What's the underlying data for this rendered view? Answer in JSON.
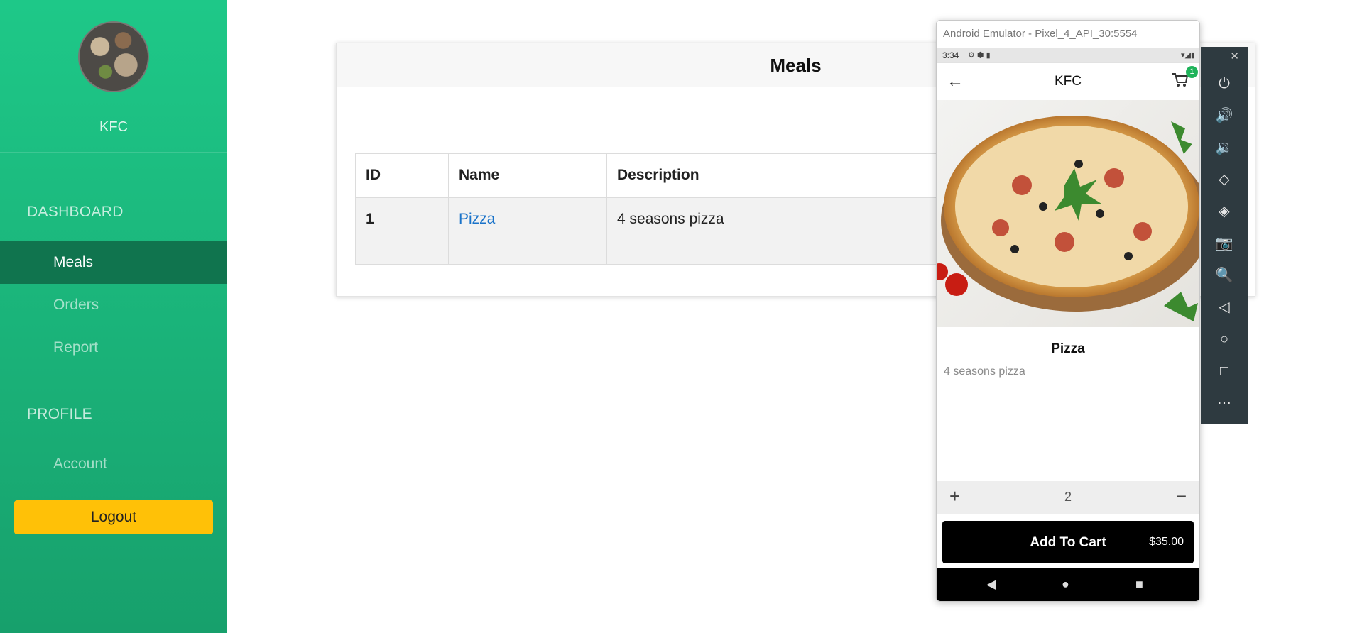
{
  "sidebar": {
    "brand": "KFC",
    "sections": {
      "dashboard": "DASHBOARD",
      "profile": "PROFILE"
    },
    "items": {
      "meals": "Meals",
      "orders": "Orders",
      "report": "Report",
      "account": "Account"
    },
    "logout": "Logout"
  },
  "main": {
    "title": "Meals",
    "table": {
      "headers": [
        "ID",
        "Name",
        "Description"
      ],
      "rows": [
        {
          "id": "1",
          "name": "Pizza",
          "description": "4 seasons pizza"
        }
      ]
    }
  },
  "emulator": {
    "window_title": "Android Emulator - Pixel_4_API_30:5554",
    "status_time": "3:34",
    "app_title": "KFC",
    "cart_count": "1",
    "meal_name": "Pizza",
    "meal_description": "4 seasons pizza",
    "quantity": "2",
    "add_to_cart": "Add To Cart",
    "price": "$35.00",
    "toolbar_icons": [
      "power-icon",
      "volume-up-icon",
      "volume-down-icon",
      "rotate-left-icon",
      "rotate-right-icon",
      "camera-icon",
      "zoom-icon",
      "back-icon",
      "home-icon",
      "overview-icon",
      "more-icon"
    ]
  },
  "colors": {
    "sidebar_top": "#1ec888",
    "sidebar_bottom": "#17a06c",
    "sidebar_active": "#10744e",
    "logout": "#ffc107",
    "link": "#1a73c9",
    "badge": "#1fb35a"
  }
}
